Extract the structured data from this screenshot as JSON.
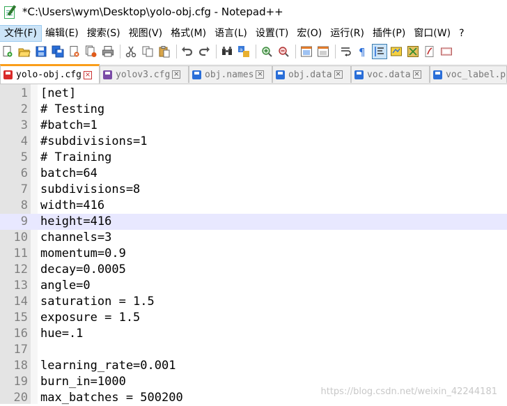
{
  "window": {
    "title": "*C:\\Users\\wym\\Desktop\\yolo-obj.cfg - Notepad++"
  },
  "menu": [
    {
      "label": "文件(F)"
    },
    {
      "label": "编辑(E)"
    },
    {
      "label": "搜索(S)"
    },
    {
      "label": "视图(V)"
    },
    {
      "label": "格式(M)"
    },
    {
      "label": "语言(L)"
    },
    {
      "label": "设置(T)"
    },
    {
      "label": "宏(O)"
    },
    {
      "label": "运行(R)"
    },
    {
      "label": "插件(P)"
    },
    {
      "label": "窗口(W)"
    },
    {
      "label": "?"
    }
  ],
  "toolbar_icons": [
    "new-file-icon",
    "open-file-icon",
    "save-icon",
    "save-all-icon",
    "close-icon",
    "close-all-icon",
    "print-icon",
    "cut-icon",
    "copy-icon",
    "paste-icon",
    "undo-icon",
    "redo-icon",
    "find-icon",
    "replace-icon",
    "zoom-in-icon",
    "zoom-out-icon",
    "sync-v-icon",
    "sync-h-icon",
    "word-wrap-icon",
    "show-all-chars-icon",
    "indent-guide-icon",
    "doc-map-icon",
    "function-list-icon",
    "folder-icon",
    "record-macro-icon"
  ],
  "tabs": [
    {
      "label": "yolo-obj.cfg",
      "active": true,
      "icon": "red"
    },
    {
      "label": "yolov3.cfg",
      "active": false,
      "icon": "purple"
    },
    {
      "label": "obj.names",
      "active": false,
      "icon": "blue"
    },
    {
      "label": "obj.data",
      "active": false,
      "icon": "blue"
    },
    {
      "label": "voc.data",
      "active": false,
      "icon": "blue"
    },
    {
      "label": "voc_label.p",
      "active": false,
      "icon": "blue"
    }
  ],
  "editor": {
    "current_line": 9,
    "lines": [
      {
        "n": "1",
        "text": "[net]"
      },
      {
        "n": "2",
        "text": "# Testing"
      },
      {
        "n": "3",
        "text": "#batch=1"
      },
      {
        "n": "4",
        "text": "#subdivisions=1"
      },
      {
        "n": "5",
        "text": "# Training"
      },
      {
        "n": "6",
        "text": "batch=64"
      },
      {
        "n": "7",
        "text": "subdivisions=8"
      },
      {
        "n": "8",
        "text": "width=416"
      },
      {
        "n": "9",
        "text": "height=416"
      },
      {
        "n": "10",
        "text": "channels=3"
      },
      {
        "n": "11",
        "text": "momentum=0.9"
      },
      {
        "n": "12",
        "text": "decay=0.0005"
      },
      {
        "n": "13",
        "text": "angle=0"
      },
      {
        "n": "14",
        "text": "saturation = 1.5"
      },
      {
        "n": "15",
        "text": "exposure = 1.5"
      },
      {
        "n": "16",
        "text": "hue=.1"
      },
      {
        "n": "17",
        "text": ""
      },
      {
        "n": "18",
        "text": "learning_rate=0.001"
      },
      {
        "n": "19",
        "text": "burn_in=1000"
      },
      {
        "n": "20",
        "text": "max_batches = 500200"
      }
    ]
  },
  "watermark": "https://blog.csdn.net/weixin_42244181",
  "colors": {
    "active_tab_accent": "#fa9e1a",
    "current_line": "#e8e8ff",
    "gutter": "#e4e4e4"
  }
}
